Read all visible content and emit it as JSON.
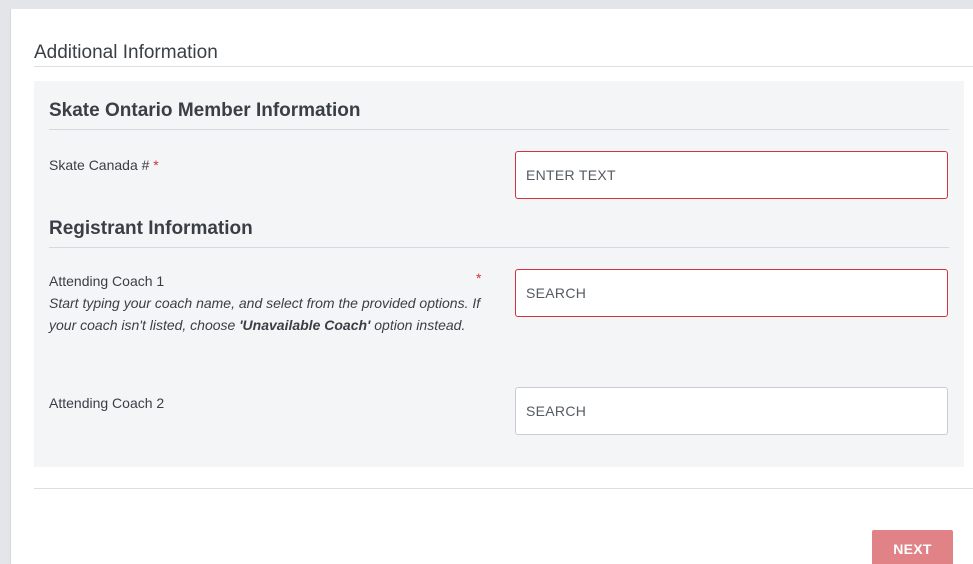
{
  "form": {
    "section_title": "Additional Information",
    "member_section": {
      "heading": "Skate Ontario Member Information",
      "skate_canada": {
        "label": "Skate Canada #",
        "required_mark": "*",
        "placeholder": "ENTER TEXT",
        "value": ""
      }
    },
    "registrant_section": {
      "heading": "Registrant Information",
      "coach1": {
        "label": "Attending Coach 1",
        "required_mark": "*",
        "help_prefix": "Start typing your coach name, and select from the provided options. If your coach isn't listed, choose ",
        "help_bold": "'Unavailable Coach'",
        "help_suffix": " option instead.",
        "placeholder": "SEARCH",
        "value": ""
      },
      "coach2": {
        "label": "Attending Coach 2",
        "placeholder": "SEARCH",
        "value": ""
      }
    }
  },
  "actions": {
    "next_label": "NEXT"
  },
  "colors": {
    "required": "#d2323c",
    "next_button": "#e08286",
    "panel_bg": "#f4f5f7"
  }
}
